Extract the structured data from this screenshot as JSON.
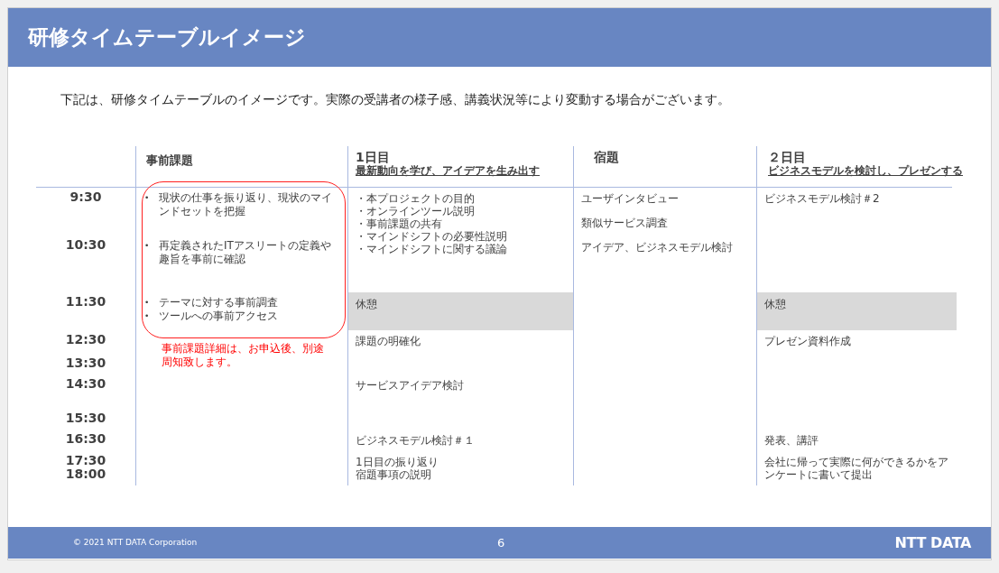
{
  "title": "研修タイムテーブルイメージ",
  "intro": "下記は、研修タイムテーブルのイメージです。実際の受講者の様子感、講義状況等により変動する場合がございます。",
  "headers": {
    "pre_study": {
      "title": "事前課題"
    },
    "day1": {
      "title": "1日目",
      "subtitle": "最新動向を学び、アイデアを生み出す"
    },
    "homework": {
      "title": "宿題"
    },
    "day2": {
      "title": "２日目",
      "subtitle": "ビジネスモデルを検討し、プレゼンする"
    }
  },
  "rows": [
    {
      "times": [
        "9:30"
      ],
      "pre_task": [
        {
          "bullet": "•",
          "text": "現状の仕事を振り返り、現状のマインドセットを把握"
        }
      ],
      "day1": {
        "kind": "list",
        "lines": [
          "・本プロジェクトの目的",
          "・オンラインツール説明",
          "・事前課題の共有",
          "・マインドシフトの必要性説明",
          "・マインドシフトに関する議論"
        ]
      },
      "homework": {
        "kind": "spaced",
        "lines": [
          "ユーザインタビュー",
          "類似サービス調査",
          "アイデア、ビジネスモデル検討"
        ]
      },
      "day2": {
        "kind": "list",
        "lines": [
          "ビジネスモデル検討＃2"
        ]
      }
    },
    {
      "times": [
        "10:30"
      ],
      "pre_task": [
        {
          "bullet": "•",
          "text": "再定義されたITアスリートの定義や趣旨を事前に確認"
        }
      ]
    },
    {
      "times": [
        "11:30"
      ],
      "pre_task": [
        {
          "bullet": "•",
          "text": "テーマに対する事前調査"
        },
        {
          "bullet": "•",
          "text": "ツールへの事前アクセス"
        }
      ],
      "day1": {
        "kind": "break",
        "lines": [
          "休憩"
        ]
      },
      "day2": {
        "kind": "break",
        "lines": [
          "休憩"
        ]
      }
    },
    {
      "times": [
        "12:30"
      ],
      "pre_note": "事前課題詳細は、お申込後、別途周知致します。",
      "day1": {
        "kind": "list",
        "lines": [
          "課題の明確化"
        ]
      },
      "day2": {
        "kind": "list",
        "lines": [
          "プレゼン資料作成"
        ]
      }
    },
    {
      "times": [
        "13:30"
      ]
    },
    {
      "times": [
        "14:30"
      ],
      "day1": {
        "kind": "list",
        "lines": [
          "サービスアイデア検討"
        ]
      }
    },
    {
      "times": [
        "15:30"
      ]
    },
    {
      "times": [
        "16:30"
      ],
      "day1": {
        "kind": "list",
        "lines": [
          "ビジネスモデル検討＃１"
        ]
      },
      "day2": {
        "kind": "list",
        "lines": [
          "発表、講評"
        ]
      }
    },
    {
      "times": [
        "17:30",
        "18:00"
      ],
      "day1": {
        "kind": "list",
        "lines": [
          "1日目の振り返り",
          "宿題事項の説明"
        ]
      },
      "day2": {
        "kind": "paragraph",
        "lines": [
          "会社に帰って実際に何ができるかをアンケートに書いて提出"
        ]
      }
    }
  ],
  "footer": {
    "copyright": "© 2021 NTT DATA Corporation",
    "page": "6",
    "logo": "NTT DATA"
  }
}
